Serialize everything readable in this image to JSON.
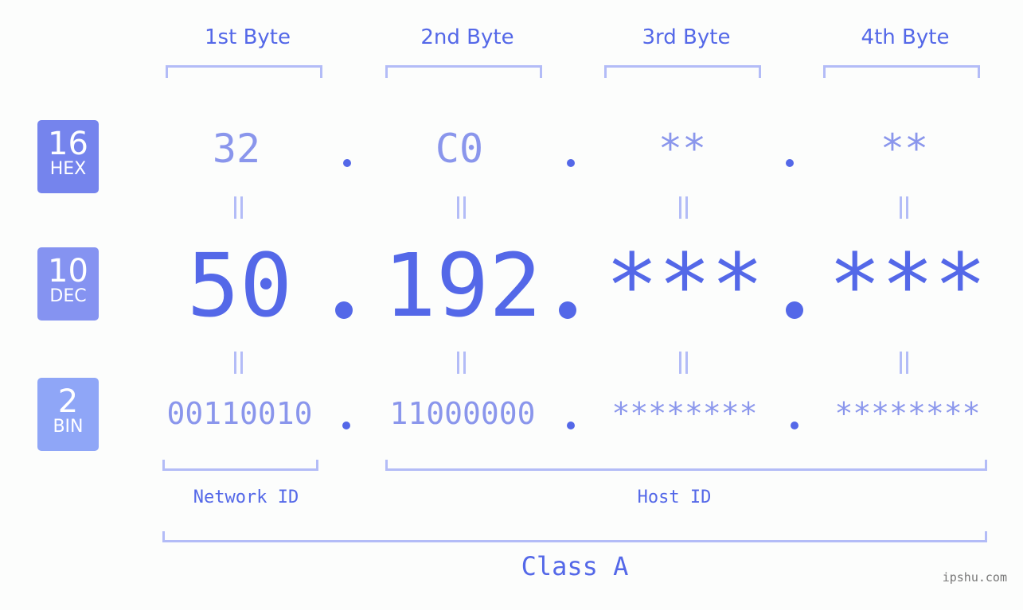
{
  "bytes": {
    "labels": [
      "1st Byte",
      "2nd Byte",
      "3rd Byte",
      "4th Byte"
    ]
  },
  "badges": {
    "hex": {
      "number": "16",
      "label": "HEX",
      "color": "#7584ed"
    },
    "dec": {
      "number": "10",
      "label": "DEC",
      "color": "#8593f1"
    },
    "bin": {
      "number": "2",
      "label": "BIN",
      "color": "#8fa6f7"
    }
  },
  "hex_values": [
    "32",
    "C0",
    "**",
    "**"
  ],
  "dec_values": [
    "50",
    "192",
    "***",
    "***"
  ],
  "bin_values": [
    "00110010",
    "11000000",
    "********",
    "********"
  ],
  "segments": {
    "network_id": "Network ID",
    "host_id": "Host ID",
    "class_label": "Class A"
  },
  "colors": {
    "accent": "#5468e8",
    "light_accent": "#8a96ec",
    "bracket": "#b3bcf7",
    "background": "#fcfdfc"
  },
  "watermark": "ipshu.com"
}
